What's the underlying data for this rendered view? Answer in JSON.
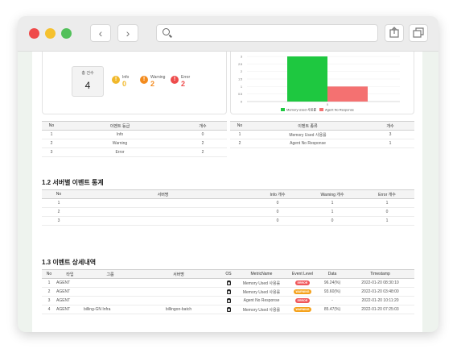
{
  "window": {
    "controls": [
      "close",
      "minimize",
      "maximize"
    ],
    "colors": {
      "close": "#ef4a4a",
      "minimize": "#f5c12e",
      "maximize": "#52c05a"
    }
  },
  "toolbar": {
    "back_icon": "chevron-left-icon",
    "forward_icon": "chevron-right-icon",
    "back_glyph": "‹",
    "forward_glyph": "›",
    "search_icon": "search-icon",
    "share_icon": "share-icon",
    "tabs_icon": "tabs-icon"
  },
  "summary": {
    "total_label": "총 건수",
    "total_value": "4",
    "info_label": "Info",
    "info_value": "0",
    "warning_label": "Warning",
    "warning_value": "2",
    "error_label": "Error",
    "error_value": "2",
    "info_glyph": "!",
    "warning_glyph": "!",
    "error_glyph": "!"
  },
  "chart_data": {
    "type": "bar",
    "categories": [
      ""
    ],
    "series": [
      {
        "name": "Memory Used 사용률",
        "values": [
          3
        ],
        "color": "#1ec840"
      },
      {
        "name": "Agent No Response",
        "values": [
          1
        ],
        "color": "#f47171"
      }
    ],
    "xtick": "0",
    "yticks": [
      "3",
      "2.5",
      "2",
      "1.5",
      "1",
      "0.5",
      "0"
    ],
    "ylim": [
      0,
      3
    ],
    "legend": "bottom"
  },
  "level_table": {
    "headers": [
      "No",
      "이벤트 등급",
      "개수"
    ],
    "rows": [
      [
        "1",
        "Info",
        "0"
      ],
      [
        "2",
        "Warning",
        "2"
      ],
      [
        "3",
        "Error",
        "2"
      ]
    ]
  },
  "type_table": {
    "headers": [
      "No",
      "이벤트 종류",
      "개수"
    ],
    "rows": [
      [
        "1",
        "Memory Used 사용률",
        "3"
      ],
      [
        "2",
        "Agent No Response",
        "1"
      ]
    ]
  },
  "server_section": {
    "title": "1.2 서버별 이벤트 통계",
    "headers": [
      "No",
      "서버명",
      "Info 개수",
      "Warning 개수",
      "Error 개수"
    ],
    "rows": [
      [
        "1",
        "",
        "0",
        "1",
        "1"
      ],
      [
        "2",
        "",
        "0",
        "1",
        "0"
      ],
      [
        "3",
        "",
        "0",
        "0",
        "1"
      ]
    ]
  },
  "detail_section": {
    "title": "1.3 이벤트 상세내역",
    "headers": [
      "No",
      "타입",
      "그룹",
      "서버명",
      "OS",
      "MetricName",
      "Event Level",
      "Data",
      "Timestamp"
    ],
    "rows": [
      {
        "no": "1",
        "type": "AGENT",
        "group": "",
        "server": "",
        "os": "linux-icon",
        "metric": "Memory Used 사용률",
        "level": "ERROR",
        "level_color": "#f0565a",
        "data": "96.24(%)",
        "ts": "2022-01-20 08:30:10"
      },
      {
        "no": "2",
        "type": "AGENT",
        "group": "",
        "server": "",
        "os": "linux-icon",
        "metric": "Memory Used 사용률",
        "level": "WARNING",
        "level_color": "#f5a21c",
        "data": "93.60(%)",
        "ts": "2022-01-20 03:48:00"
      },
      {
        "no": "3",
        "type": "AGENT",
        "group": "",
        "server": "",
        "os": "linux-icon",
        "metric": "Agent No Response",
        "level": "ERROR",
        "level_color": "#f0565a",
        "data": "-",
        "ts": "2022-01-20 10:11:20"
      },
      {
        "no": "4",
        "type": "AGENT",
        "group": "billing-GN Infra",
        "server": "billingon-batch",
        "os": "linux-icon",
        "metric": "Memory Used 사용률",
        "level": "WARNING",
        "level_color": "#f5a21c",
        "data": "85.47(%)",
        "ts": "2022-01-20 07:25:03"
      }
    ]
  }
}
